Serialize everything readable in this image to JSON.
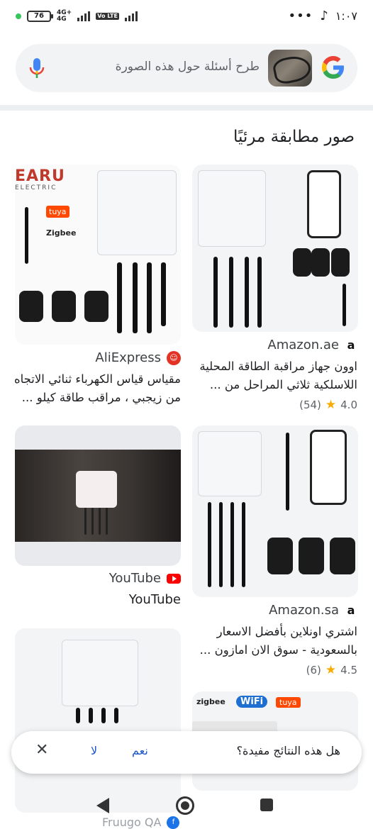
{
  "status_bar": {
    "time": "١:٠٧",
    "battery": "76",
    "network": "4G+",
    "network2": "4G",
    "lte": "Vo LTE"
  },
  "search": {
    "placeholder": "طرح أسئلة حول هذه الصورة"
  },
  "section_title": "صور مطابقة مرئيًا",
  "results": [
    {
      "source": "Amazon.ae",
      "source_icon": "amazon-icon",
      "title_line1": "اوون جهاز مراقبة الطاقة المحلية",
      "title_line2": "اللاسلكية ثلاثي المراحل من ...",
      "rating": "4.0",
      "reviews": "(54)"
    },
    {
      "source": "AliExpress",
      "source_icon": "aliexpress-icon",
      "title_line1": "مقياس قياس الكهرباء ثنائي الاتجاه",
      "title_line2": "من زيجبي ، مراقب طاقة كيلو ...",
      "brand_text1": "EARU",
      "brand_text2": "ELECTRIC",
      "badge1": "tuya",
      "badge2": "Zigbee"
    },
    {
      "source": "Amazon.sa",
      "source_icon": "amazon-icon",
      "title_line1": "اشتري اونلاين بأفضل الاسعار",
      "title_line2": "بالسعودية - سوق الان امازون ...",
      "rating": "4.5",
      "reviews": "(6)"
    },
    {
      "source": "YouTube",
      "source_icon": "youtube-icon",
      "title_line1": "YouTube"
    },
    {
      "source": "Fruugo QA",
      "source_icon": "fruugo-icon",
      "badge1": "zigbee",
      "badge2": "WiFi",
      "badge3": "tuya"
    }
  ],
  "feedback": {
    "question": "هل هذه النتائج مفيدة؟",
    "yes": "نعم",
    "no": "لا"
  },
  "colors": {
    "link_blue": "#1a56c8",
    "star": "#f9ab00",
    "youtube_red": "#ff0000",
    "aliexpress_red": "#e43225"
  }
}
